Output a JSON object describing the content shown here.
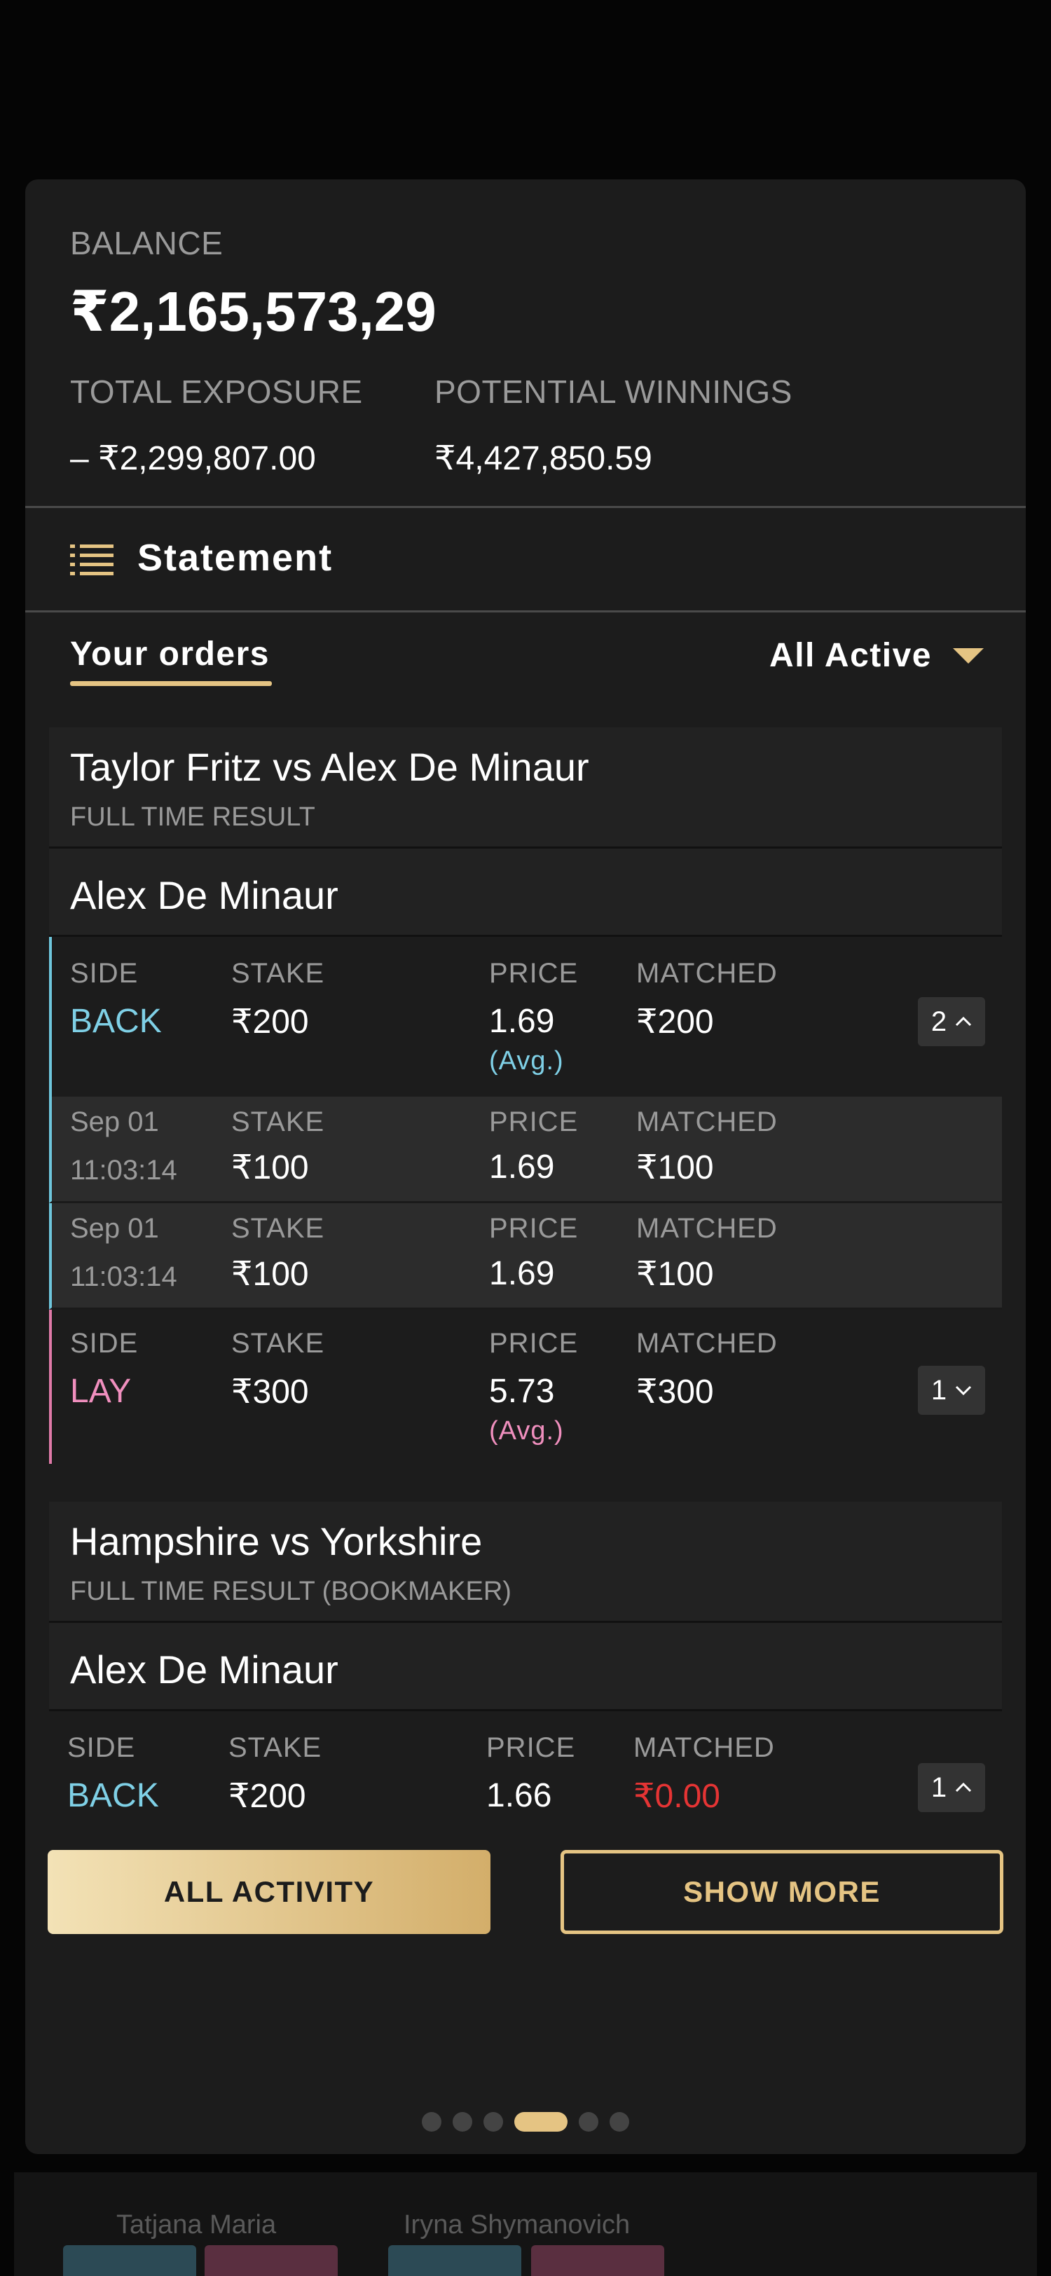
{
  "background": {
    "players": [
      "Tatjana Maria",
      "Iryna Shymanovich"
    ]
  },
  "account": {
    "balance_label": "BALANCE",
    "balance_value": "₹2,165,573,29",
    "exposure_label": "TOTAL EXPOSURE",
    "exposure_value": "– ₹2,299,807.00",
    "winnings_label": "POTENTIAL WINNINGS",
    "winnings_value": "₹4,427,850.59"
  },
  "statement": {
    "label": "Statement",
    "icon": "list-icon"
  },
  "orders": {
    "tab_label": "Your orders",
    "filter_label": "All Active"
  },
  "markets": [
    {
      "title": "Taylor Fritz vs Alex De Minaur",
      "subtitle": "FULL TIME RESULT",
      "selection": "Alex De Minaur",
      "bets": [
        {
          "side_label": "SIDE",
          "side": "BACK",
          "stake_label": "STAKE",
          "stake": "₹200",
          "price_label": "PRICE",
          "price": "1.69",
          "price_note": "(Avg.)",
          "matched_label": "MATCHED",
          "matched": "₹200",
          "count": "2",
          "fills": [
            {
              "date": "Sep 01",
              "time": "11:03:14",
              "stake_label": "STAKE",
              "stake": "₹100",
              "price_label": "PRICE",
              "price": "1.69",
              "matched_label": "MATCHED",
              "matched": "₹100"
            },
            {
              "date": "Sep 01",
              "time": "11:03:14",
              "stake_label": "STAKE",
              "stake": "₹100",
              "price_label": "PRICE",
              "price": "1.69",
              "matched_label": "MATCHED",
              "matched": "₹100"
            }
          ]
        },
        {
          "side_label": "SIDE",
          "side": "LAY",
          "stake_label": "STAKE",
          "stake": "₹300",
          "price_label": "PRICE",
          "price": "5.73",
          "price_note": "(Avg.)",
          "matched_label": "MATCHED",
          "matched": "₹300",
          "count": "1"
        }
      ]
    },
    {
      "title": "Hampshire vs Yorkshire",
      "subtitle": "FULL TIME RESULT (BOOKMAKER)",
      "selection": "Alex De Minaur",
      "bets": [
        {
          "side_label": "SIDE",
          "side": "BACK",
          "stake_label": "STAKE",
          "stake": "₹200",
          "price_label": "PRICE",
          "price": "1.66",
          "matched_label": "MATCHED",
          "matched": "₹0.00",
          "count": "1"
        }
      ]
    }
  ],
  "actions": {
    "all_activity": "ALL ACTIVITY",
    "show_more": "SHOW MORE"
  },
  "pagination": {
    "pages": 6,
    "active_index": 3
  },
  "colors": {
    "gold": "#e5c483",
    "back": "#7fd0e6",
    "lay": "#f08fbe",
    "unmatched": "#e53434"
  }
}
